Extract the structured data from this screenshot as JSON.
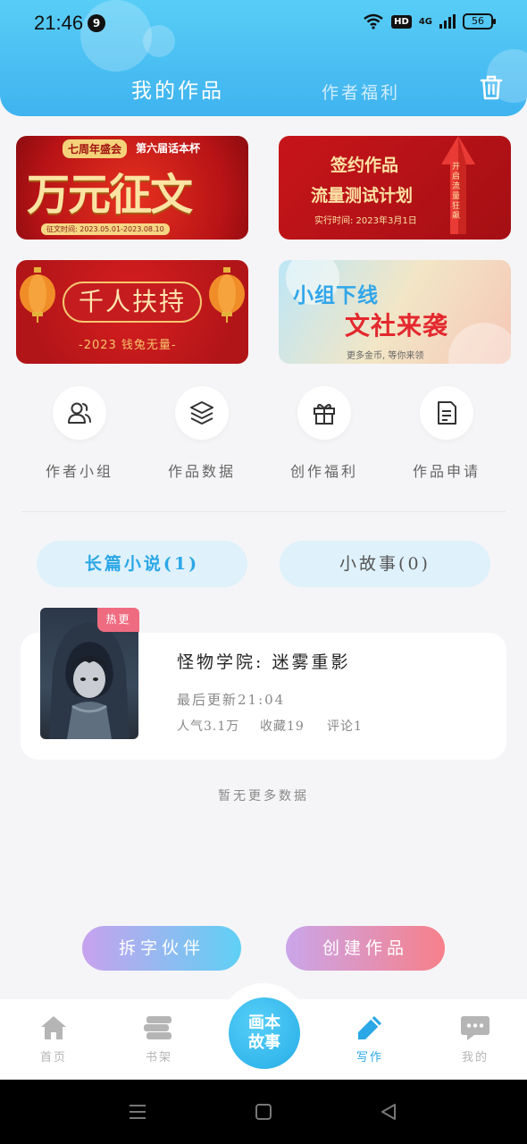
{
  "status_bar": {
    "time": "21:46",
    "notification_count": "9",
    "hd": "HD",
    "network": "4G",
    "battery": "56"
  },
  "header": {
    "tabs": [
      {
        "label": "我的作品",
        "active": true
      },
      {
        "label": "作者福利",
        "active": false
      }
    ],
    "trash_icon": "trash-icon",
    "colors": {
      "top": "#58cdf6",
      "bottom": "#3fb3ef"
    }
  },
  "banners": [
    {
      "badge": "七周年盛会",
      "tag": "第六届话本杯",
      "headline": "万元征文",
      "sub": "征文时间: 2023.05.01-2023.08.10"
    },
    {
      "line1": "签约作品",
      "line2": "流量测试计划",
      "line3": "实行时间: 2023年3月1日",
      "arrow_text": "开启流量狂飙"
    },
    {
      "headline": "千人扶持",
      "sub": "-2023 钱兔无量-"
    },
    {
      "line1": "小组下线",
      "line2": "文社来袭",
      "line3": "更多金币, 等你来领"
    }
  ],
  "functions": [
    {
      "label": "作者小组",
      "icon": "users-icon"
    },
    {
      "label": "作品数据",
      "icon": "layers-icon"
    },
    {
      "label": "创作福利",
      "icon": "gift-icon"
    },
    {
      "label": "作品申请",
      "icon": "document-icon"
    }
  ],
  "category_tabs": [
    {
      "label": "长篇小说(1)",
      "active": true
    },
    {
      "label": "小故事(0)",
      "active": false
    }
  ],
  "works": [
    {
      "badge": "热更",
      "title": "怪物学院: 迷雾重影",
      "updated": "最后更新21:04",
      "popularity": "人气3.1万",
      "favorites": "收藏19",
      "comments": "评论1"
    }
  ],
  "no_more": "暂无更多数据",
  "actions": {
    "partner": "拆字伙伴",
    "create": "创建作品"
  },
  "bottom_nav": {
    "items": [
      {
        "label": "首页",
        "icon": "home-icon"
      },
      {
        "label": "书架",
        "icon": "bookshelf-icon"
      },
      {
        "label": "写作",
        "icon": "pen-icon",
        "active": true
      },
      {
        "label": "我的",
        "icon": "chat-icon"
      }
    ],
    "center": {
      "line1": "画本",
      "line2": "故事"
    },
    "active_color": "#2aa7e6"
  }
}
